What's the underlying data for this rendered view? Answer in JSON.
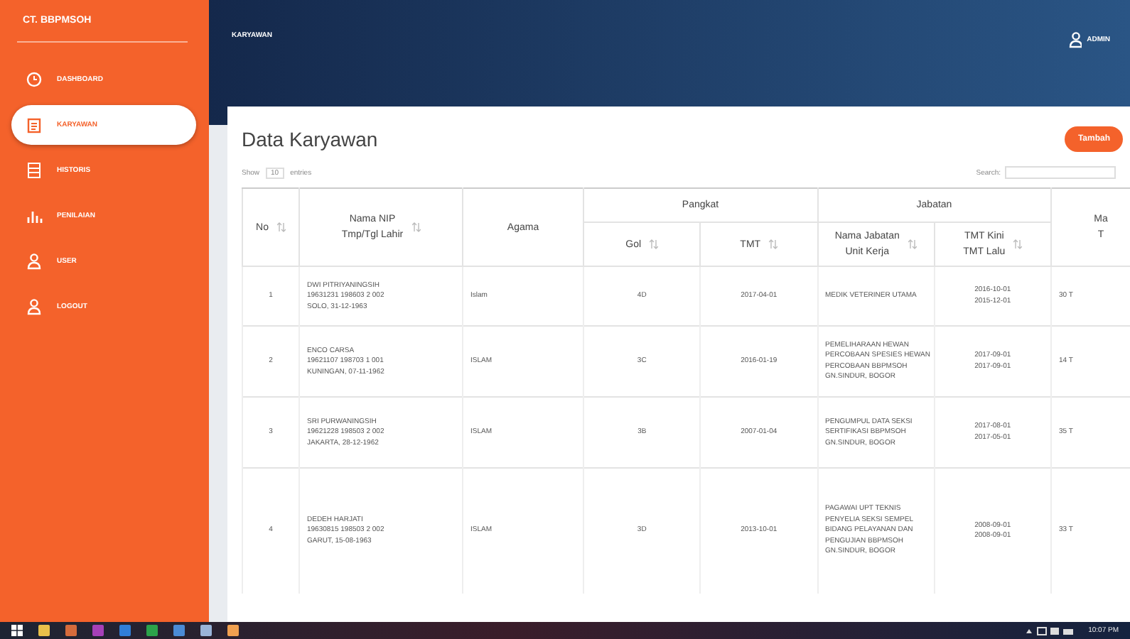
{
  "brand": "CT. BBPMSOH",
  "sidebar": {
    "items": [
      {
        "label": "DASHBOARD",
        "kind": "clock",
        "selected": false
      },
      {
        "label": "KARYAWAN",
        "kind": "clipboard",
        "selected": true
      },
      {
        "label": "HISTORIS",
        "kind": "list",
        "selected": false
      },
      {
        "label": "PENILAIAN",
        "kind": "chart",
        "selected": false
      },
      {
        "label": "USER",
        "kind": "user",
        "selected": false
      },
      {
        "label": "LOGOUT",
        "kind": "user",
        "selected": false
      }
    ]
  },
  "header": {
    "breadcrumb": "KARYAWAN",
    "user": "ADMIN"
  },
  "page": {
    "title": "Data Karyawan",
    "add_button": "Tambah",
    "show_label": "Show",
    "show_value": "10",
    "entries_label": "entries",
    "search_label": "Search:"
  },
  "table": {
    "columns": {
      "no": "No",
      "nama": [
        "Nama NIP",
        "Tmp/Tgl Lahir"
      ],
      "agama": "Agama",
      "pangkat": "Pangkat",
      "gol": "Gol",
      "tmt": "TMT",
      "jabatan": "Jabatan",
      "nama_jabatan": [
        "Nama Jabatan",
        "Unit Kerja"
      ],
      "tmt_kini": [
        "TMT Kini",
        "TMT Lalu"
      ],
      "column_9": [
        "Ma",
        "T"
      ]
    },
    "rows": [
      {
        "no": "1",
        "nama": [
          "DWI PITRIYANINGSIH",
          "19631231 198603 2 002",
          "SOLO, 31-12-1963"
        ],
        "agama": "Islam",
        "gol": "4D",
        "tmt": "2017-04-01",
        "jabatan": [
          "MEDIK VETERINER UTAMA"
        ],
        "tmt_kini": [
          "2016-10-01",
          "2015-12-01"
        ],
        "column_9": "30 T"
      },
      {
        "no": "2",
        "nama": [
          "ENCO CARSA",
          "19621107 198703 1 001",
          "KUNINGAN, 07-11-1962"
        ],
        "agama": "ISLAM",
        "gol": "3C",
        "tmt": "2016-01-19",
        "jabatan": [
          "PEMELIHARAAN HEWAN",
          "PERCOBAAN SPESIES HEWAN",
          "PERCOBAAN BBPMSOH",
          "GN.SINDUR, BOGOR"
        ],
        "tmt_kini": [
          "2017-09-01",
          "2017-09-01"
        ],
        "column_9": "14 T"
      },
      {
        "no": "3",
        "nama": [
          "SRI PURWANINGSIH",
          "19621228 198503 2 002",
          "JAKARTA, 28-12-1962"
        ],
        "agama": "ISLAM",
        "gol": "3B",
        "tmt": "2007-01-04",
        "jabatan": [
          "PENGUMPUL DATA SEKSI",
          "SERTIFIKASI BBPMSOH",
          "GN.SINDUR, BOGOR"
        ],
        "tmt_kini": [
          "2017-08-01",
          "2017-05-01"
        ],
        "column_9": "35 T"
      },
      {
        "no": "4",
        "nama": [
          "DEDEH HARJATI",
          "19630815 198503 2 002",
          "GARUT, 15-08-1963"
        ],
        "agama": "ISLAM",
        "gol": "3D",
        "tmt": "2013-10-01",
        "jabatan": [
          "PAGAWAI UPT TEKNIS",
          "PENYELIA SEKSI SEMPEL",
          "BIDANG PELAYANAN DAN",
          "PENGUJIAN BBPMSOH",
          "GN.SINDUR, BOGOR"
        ],
        "tmt_kini": [
          "2008-09-01",
          "2008-09-01"
        ],
        "column_9": "33 T"
      }
    ]
  },
  "taskbar": {
    "time": "10:07 PM"
  }
}
